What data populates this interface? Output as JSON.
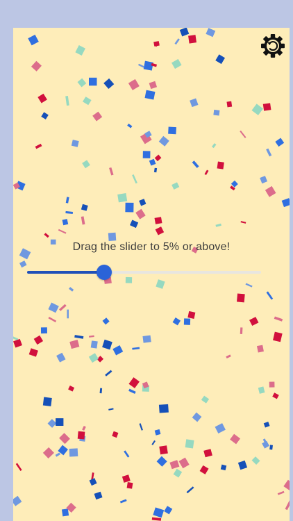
{
  "prompt": {
    "text": "Drag the slider to 5% or above!"
  },
  "slider": {
    "value_percent": 33
  },
  "settings": {
    "icon": "gear-reset-icon"
  },
  "colors": {
    "background": "#feedb9",
    "accent": "#2a63d8",
    "confetti": [
      "#d1103d",
      "#2f6fe0",
      "#1550b8",
      "#96d9c0",
      "#dc6d8b",
      "#6f98e0"
    ]
  }
}
